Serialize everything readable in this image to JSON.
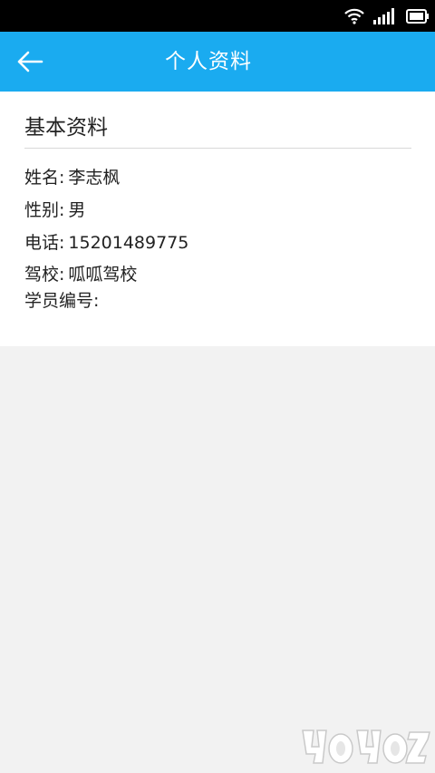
{
  "header": {
    "title": "个人资料"
  },
  "profile": {
    "section_title": "基本资料",
    "fields": [
      {
        "label": "姓名:",
        "value": "李志枫"
      },
      {
        "label": "性别:",
        "value": "男"
      },
      {
        "label": "电话:",
        "value": "15201489775"
      },
      {
        "label": "驾校:",
        "value": "呱呱驾校"
      },
      {
        "label": "学员编号:",
        "value": ""
      }
    ]
  },
  "icons": {
    "back": "arrow-left-icon",
    "wifi": "wifi-icon",
    "signal": "signal-icon",
    "battery": "battery-icon"
  },
  "colors": {
    "app_bar": "#1aabf0",
    "status_bar": "#000000",
    "background": "#f2f2f2",
    "card": "#ffffff"
  }
}
